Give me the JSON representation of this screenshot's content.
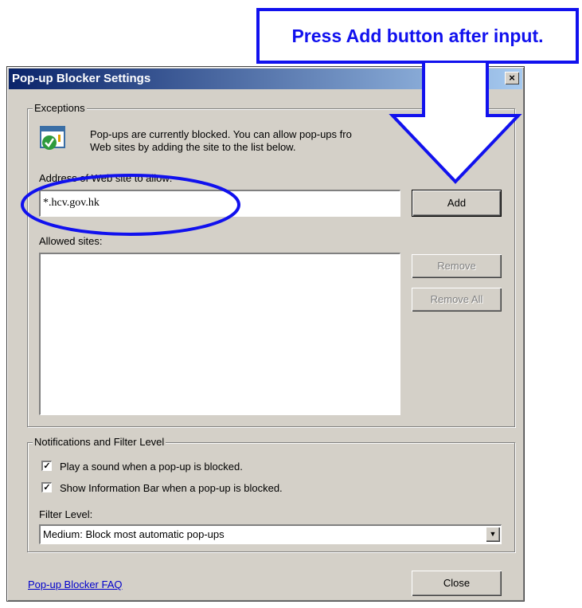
{
  "callout": {
    "text": "Press Add button after input."
  },
  "dialog": {
    "title": "Pop-up Blocker Settings",
    "close_glyph": "×",
    "exceptions": {
      "legend": "Exceptions",
      "info_line1": "Pop-ups are currently blocked.  You can allow pop-ups fro",
      "info_line2": "Web sites by adding the site to the list below.",
      "address_label": "Address of Web site to allow:",
      "address_value": "*.hcv.gov.hk",
      "add_button": "Add",
      "allowed_label": "Allowed sites:",
      "remove_button": "Remove",
      "remove_all_button": "Remove All"
    },
    "notifications": {
      "legend": "Notifications and Filter Level",
      "play_sound_label": "Play a sound when a pop-up is blocked.",
      "play_sound_checked": true,
      "info_bar_label": "Show Information Bar when a pop-up is blocked.",
      "info_bar_checked": true,
      "check_glyph": "✓",
      "filter_label": "Filter Level:",
      "filter_value": "Medium: Block most automatic pop-ups",
      "dropdown_glyph": "▼"
    },
    "faq_link": "Pop-up Blocker FAQ",
    "close_button": "Close"
  },
  "annotation_color": "#1111ee"
}
